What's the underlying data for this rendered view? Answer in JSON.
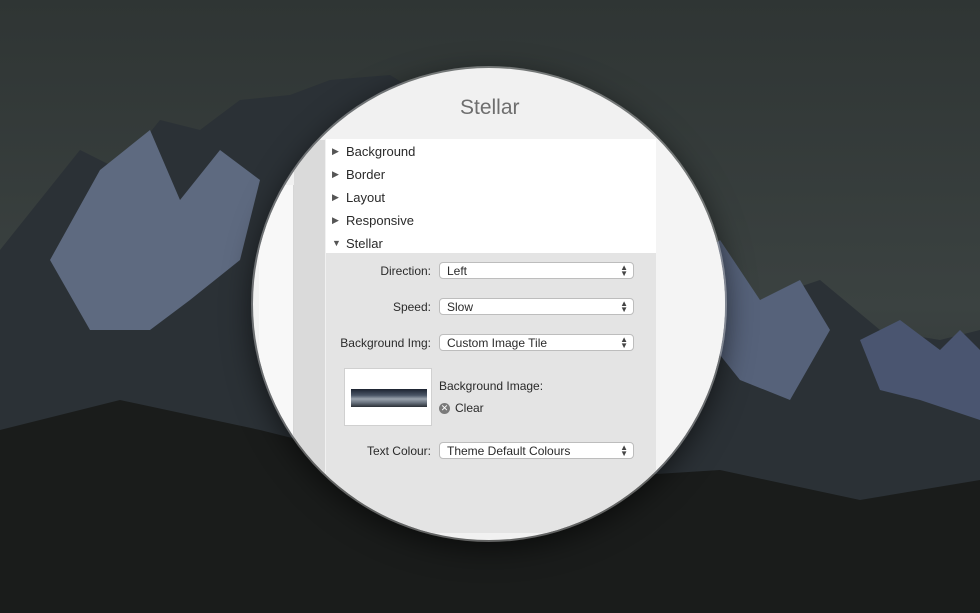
{
  "panel": {
    "title": "Stellar",
    "sections": [
      {
        "label": "Background",
        "expanded": false
      },
      {
        "label": "Border",
        "expanded": false
      },
      {
        "label": "Layout",
        "expanded": false
      },
      {
        "label": "Responsive",
        "expanded": false
      },
      {
        "label": "Stellar",
        "expanded": true
      }
    ]
  },
  "stellar_settings": {
    "direction": {
      "label": "Direction:",
      "value": "Left"
    },
    "speed": {
      "label": "Speed:",
      "value": "Slow"
    },
    "background_img": {
      "label": "Background Img:",
      "value": "Custom Image Tile"
    },
    "background_image": {
      "label": "Background Image:",
      "clear_label": "Clear"
    },
    "text_colour": {
      "label": "Text Colour:",
      "value": "Theme Default Colours"
    }
  },
  "icons": {
    "collapsed": "disclosure-right-icon",
    "expanded": "disclosure-down-icon",
    "select": "select-chevron-icon",
    "clear": "clear-circle-icon"
  },
  "colors": {
    "panel_bg": "#e4e4e4",
    "list_bg": "#ffffff",
    "title": "#6e6e6e"
  }
}
